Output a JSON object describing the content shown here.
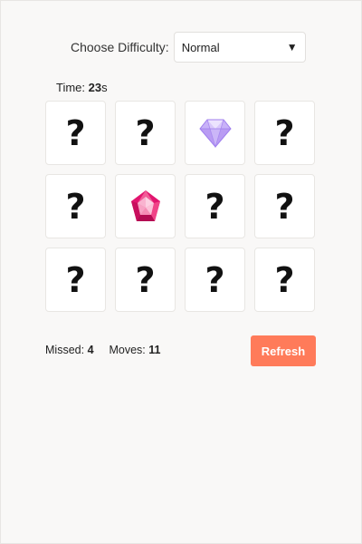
{
  "difficulty": {
    "label": "Choose Difficulty:",
    "selected": "Normal"
  },
  "timer": {
    "label": "Time: ",
    "value": "23",
    "unit": "s"
  },
  "cards": [
    {
      "state": "hidden",
      "symbol": "?"
    },
    {
      "state": "hidden",
      "symbol": "?"
    },
    {
      "state": "revealed",
      "icon": "purple-diamond-icon",
      "color": "#b79cf2"
    },
    {
      "state": "hidden",
      "symbol": "?"
    },
    {
      "state": "hidden",
      "symbol": "?"
    },
    {
      "state": "revealed",
      "icon": "pink-pentagon-gem-icon",
      "color": "#e8207a"
    },
    {
      "state": "hidden",
      "symbol": "?"
    },
    {
      "state": "hidden",
      "symbol": "?"
    },
    {
      "state": "hidden",
      "symbol": "?"
    },
    {
      "state": "hidden",
      "symbol": "?"
    },
    {
      "state": "hidden",
      "symbol": "?"
    },
    {
      "state": "hidden",
      "symbol": "?"
    }
  ],
  "stats": {
    "missed_label": "Missed:",
    "missed_value": "4",
    "moves_label": "Moves:",
    "moves_value": "11"
  },
  "refresh": {
    "label": "Refresh",
    "color": "#ff7b5a"
  }
}
